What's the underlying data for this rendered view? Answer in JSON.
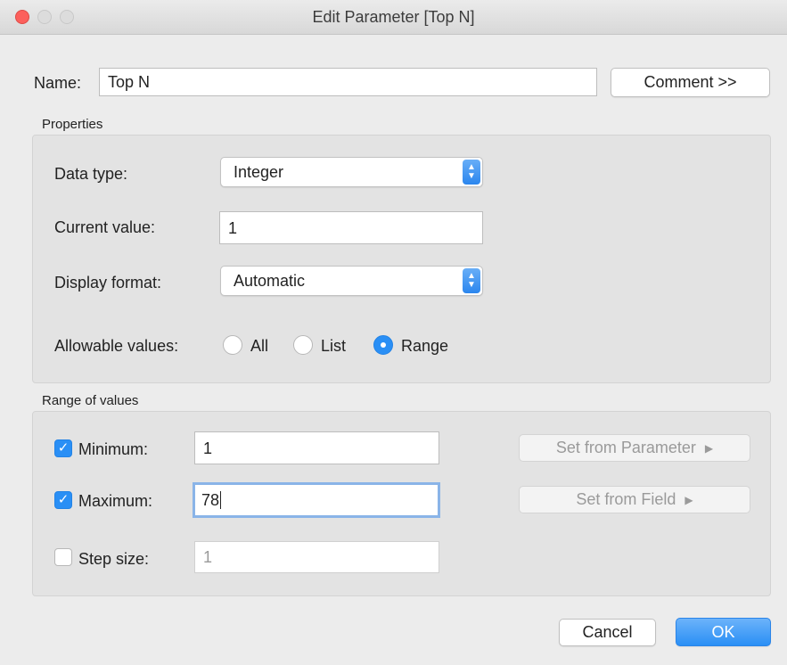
{
  "window": {
    "title": "Edit Parameter [Top N]"
  },
  "name_row": {
    "label": "Name:",
    "value": "Top N",
    "comment_button": "Comment >>"
  },
  "properties": {
    "heading": "Properties",
    "data_type_label": "Data type:",
    "data_type_value": "Integer",
    "current_value_label": "Current value:",
    "current_value": "1",
    "display_format_label": "Display format:",
    "display_format_value": "Automatic",
    "allowable_label": "Allowable values:",
    "allowable_options": [
      "All",
      "List",
      "Range"
    ],
    "allowable_selected": "Range"
  },
  "range": {
    "heading": "Range of values",
    "minimum_label": "Minimum:",
    "minimum_value": "1",
    "minimum_checked": true,
    "maximum_label": "Maximum:",
    "maximum_value": "78",
    "maximum_checked": true,
    "step_label": "Step size:",
    "step_value": "1",
    "step_checked": false,
    "set_from_parameter": "Set from Parameter",
    "set_from_field": "Set from Field"
  },
  "footer": {
    "cancel": "Cancel",
    "ok": "OK"
  },
  "colors": {
    "accent": "#2a8ff5",
    "close_button": "#fc605c",
    "background": "#ececec"
  }
}
